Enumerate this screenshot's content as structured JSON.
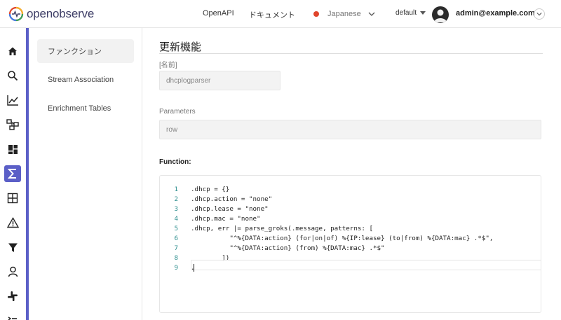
{
  "header": {
    "logo_text": "openobserve",
    "links": {
      "openapi": "OpenAPI",
      "docs": "ドキュメント"
    },
    "language": "Japanese",
    "org": "default",
    "user": "admin@example.com"
  },
  "rail": {
    "icons": [
      "home-icon",
      "search-icon",
      "metrics-icon",
      "traces-icon",
      "dashboards-icon",
      "functions-icon",
      "streams-icon",
      "alerts-icon",
      "ingestion-icon",
      "iam-icon",
      "slack-icon"
    ],
    "active": "functions-icon",
    "accent": "#5b5fc7"
  },
  "subnav": {
    "items": [
      {
        "label": "ファンクション"
      },
      {
        "label": "Stream Association"
      },
      {
        "label": "Enrichment Tables"
      }
    ]
  },
  "main": {
    "title": "更新機能",
    "name_label": "[名前]",
    "name_value": "dhcplogparser",
    "params_label": "Parameters",
    "params_value": "row",
    "function_label": "Function:"
  },
  "code": {
    "lines": [
      {
        "n": "1",
        "text": ".dhcp = {}"
      },
      {
        "n": "2",
        "text": ".dhcp.action = \"none\""
      },
      {
        "n": "3",
        "text": ".dhcp.lease = \"none\""
      },
      {
        "n": "4",
        "text": ".dhcp.mac = \"none\""
      },
      {
        "n": "5",
        "text": ".dhcp, err |= parse_groks(.message, patterns: ["
      },
      {
        "n": "6",
        "text": "          \"^%{DATA:action} (for|on|of) %{IP:lease} (to|from) %{DATA:mac} .*$\","
      },
      {
        "n": "7",
        "text": "          \"^%{DATA:action} (from) %{DATA:mac} .*$\""
      },
      {
        "n": "8",
        "text": "        ])"
      },
      {
        "n": "9",
        "text": "."
      }
    ]
  }
}
